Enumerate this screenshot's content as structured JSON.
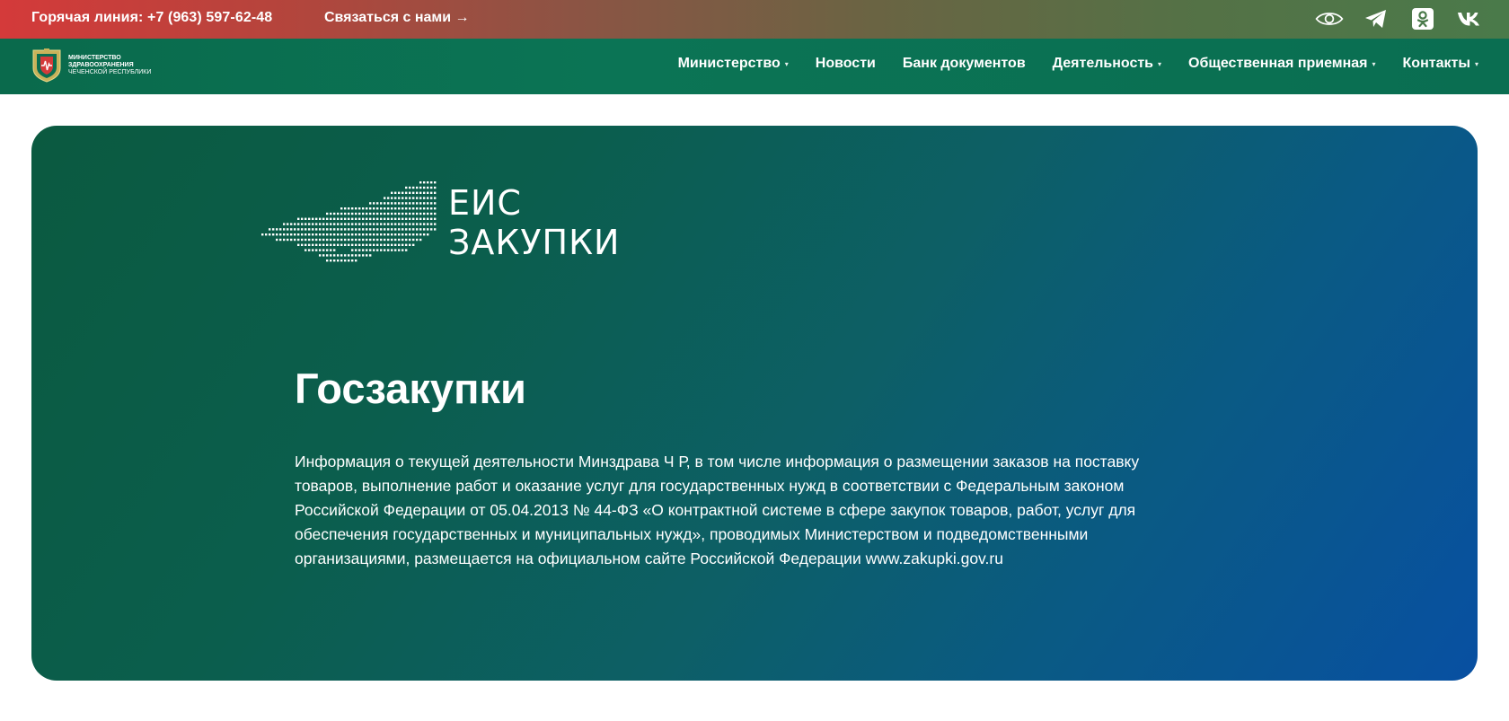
{
  "topbar": {
    "hotline": "Горячая линия: +7 (963) 597-62-48",
    "contact_link": "Связаться с нами →",
    "icons": [
      "eye-icon",
      "telegram-icon",
      "odnoklassniki-icon",
      "vk-icon"
    ]
  },
  "logo": {
    "line1": "МИНИСТЕРСТВО",
    "line2": "ЗДРАВООХРАНЕНИЯ",
    "line3": "ЧЕЧЕНСКОЙ РЕСПУБЛИКИ"
  },
  "nav": {
    "items": [
      {
        "label": "Министерство",
        "dropdown": true
      },
      {
        "label": "Новости",
        "dropdown": false
      },
      {
        "label": "Банк документов",
        "dropdown": false
      },
      {
        "label": "Деятельность",
        "dropdown": true
      },
      {
        "label": "Общественная приемная",
        "dropdown": true
      },
      {
        "label": "Контакты",
        "dropdown": true
      }
    ],
    "caret": "▾"
  },
  "hero": {
    "logo_line1": "ЕИС",
    "logo_line2": "ЗАКУПКИ",
    "title": "Госзакупки",
    "text": "Информация о текущей деятельности Минздрава Ч Р, в том числе информация о размещении заказов на поставку товаров, выполнение работ и оказание услуг для государственных нужд в соответствии с Федеральным законом Российской Федерации от 05.04.2013 № 44-ФЗ «О контрактной системе в сфере закупок товаров, работ, услуг для обеспечения государственных и муниципальных нужд», проводимых Министерством и подведомственными организациями, размещается на официальном сайте Российской Федерации www.zakupki.gov.ru"
  },
  "colors": {
    "topbar_start": "#d43a3a",
    "topbar_end": "#4a7a4a",
    "nav_bg": "#0b7455",
    "hero_start": "#0b5a40",
    "hero_end": "#0850a2"
  }
}
